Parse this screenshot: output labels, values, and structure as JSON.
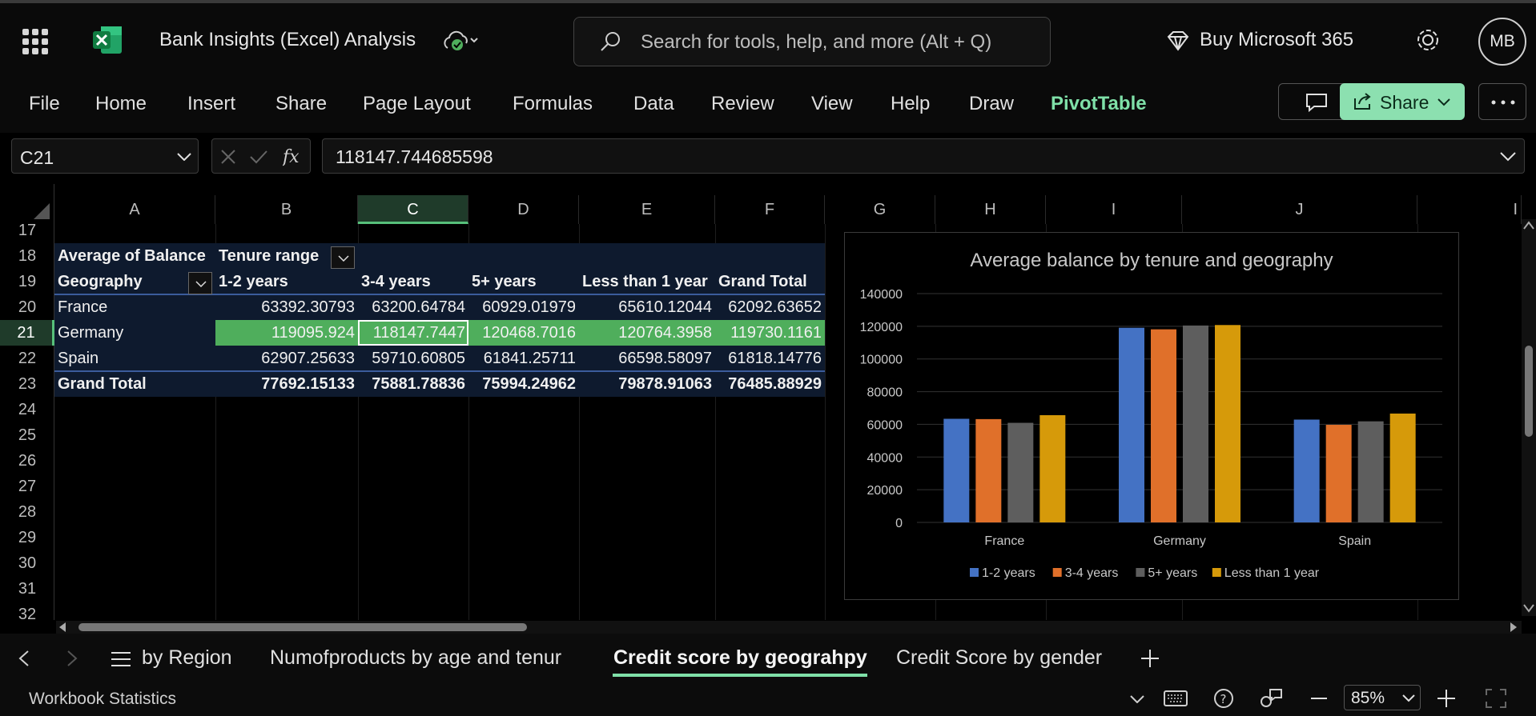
{
  "app": {
    "title": "Bank Insights (Excel) Analysis",
    "search_placeholder": "Search for tools, help, and more (Alt + Q)",
    "buy_label": "Buy Microsoft 365",
    "user_initials": "MB"
  },
  "ribbon": {
    "tabs": [
      "File",
      "Home",
      "Insert",
      "Share",
      "Page Layout",
      "Formulas",
      "Data",
      "Review",
      "View",
      "Help",
      "Draw",
      "PivotTable"
    ],
    "active_tab": "PivotTable",
    "share_label": "Share"
  },
  "formula_bar": {
    "name_box": "C21",
    "formula": "118147.744685598"
  },
  "grid": {
    "columns": [
      "A",
      "B",
      "C",
      "D",
      "E",
      "F",
      "G",
      "H",
      "I",
      "J",
      "I"
    ],
    "selected_column": "C",
    "rows": [
      "17",
      "18",
      "19",
      "20",
      "21",
      "22",
      "23",
      "24",
      "25",
      "26",
      "27",
      "28",
      "29",
      "30",
      "31",
      "32"
    ],
    "selected_row": "21"
  },
  "pivot": {
    "value_field": "Average of Balance",
    "column_field": "Tenure range",
    "row_field": "Geography",
    "headers": [
      "1-2 years",
      "3-4 years",
      "5+ years",
      "Less than 1 year",
      "Grand Total"
    ],
    "rows": [
      {
        "label": "France",
        "values": [
          "63392.30793",
          "63200.64784",
          "60929.01979",
          "65610.12044",
          "62092.63652"
        ]
      },
      {
        "label": "Germany",
        "values": [
          "119095.924",
          "118147.7447",
          "120468.7016",
          "120764.3958",
          "119730.1161"
        ]
      },
      {
        "label": "Spain",
        "values": [
          "62907.25633",
          "59710.60805",
          "61841.25711",
          "66598.58097",
          "61818.14776"
        ]
      }
    ],
    "grand_total": {
      "label": "Grand Total",
      "values": [
        "77692.15133",
        "75881.78836",
        "75994.24962",
        "79878.91063",
        "76485.88929"
      ]
    }
  },
  "chart_data": {
    "type": "bar",
    "title": "Average balance by tenure and geography",
    "categories": [
      "France",
      "Germany",
      "Spain"
    ],
    "series": [
      {
        "name": "1-2 years",
        "color": "#4472c4",
        "values": [
          63392.30793,
          119095.924,
          62907.25633
        ]
      },
      {
        "name": "3-4 years",
        "color": "#e0702a",
        "values": [
          63200.64784,
          118147.7447,
          59710.60805
        ]
      },
      {
        "name": "5+ years",
        "color": "#5e5e5e",
        "values": [
          60929.01979,
          120468.7016,
          61841.25711
        ]
      },
      {
        "name": "Less than 1 year",
        "color": "#d69a0a",
        "values": [
          65610.12044,
          120764.3958,
          66598.58097
        ]
      }
    ],
    "ylim": [
      0,
      140000
    ],
    "yticks": [
      "0",
      "20000",
      "40000",
      "60000",
      "80000",
      "100000",
      "120000",
      "140000"
    ],
    "grid": true,
    "legend": "bottom"
  },
  "sheets": {
    "tabs": [
      "by Region",
      "Numofproducts by age and tenur",
      "Credit score by geograhpy",
      "Credit Score by gender"
    ],
    "active": "Credit score by geograhpy"
  },
  "status": {
    "label": "Workbook Statistics",
    "zoom": "85%"
  }
}
